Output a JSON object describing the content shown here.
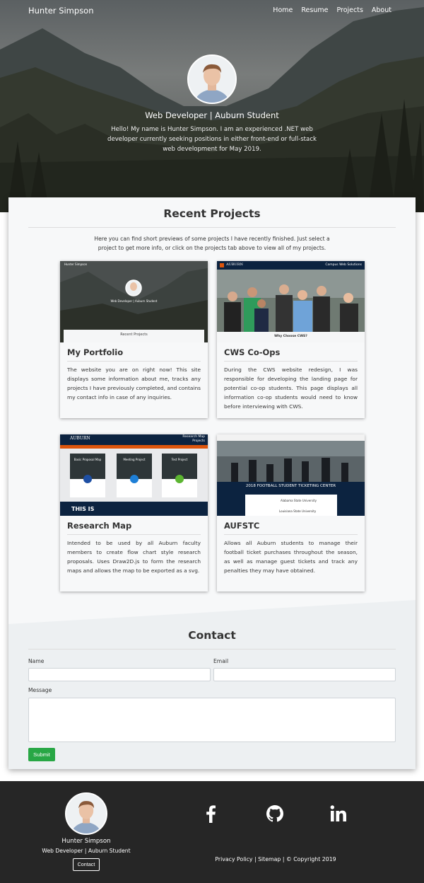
{
  "brand": "Hunter Simpson",
  "nav": [
    "Home",
    "Resume",
    "Projects",
    "About"
  ],
  "hero": {
    "tagline": "Web Developer | Auburn Student",
    "intro": "Hello! My name is Hunter Simpson. I am an experienced .NET web developer currently seeking positions in either front-end or full-stack web development for May 2019."
  },
  "projects": {
    "title": "Recent Projects",
    "intro": "Here you can find short previews of some projects I have recently finished. Just select a project to get more info, or click on the projects tab above to view all of my projects.",
    "items": [
      {
        "title": "My Portfolio",
        "description": "The website you are on right now! This site displays some information about me, tracks any projects I have previously completed, and contains my contact info in case of any inquiries.",
        "thumb": {
          "nav": "Hunter Simpson",
          "tagline": "Web Developer | Auburn Student",
          "button": "Recent Projects"
        }
      },
      {
        "title": "CWS Co-Ops",
        "description": "During the CWS website redesign, I was responsible for developing the landing page for potential co-op students. This page displays all information co-op students would need to know before interviewing with CWS.",
        "thumb": {
          "brand": "AUBURN",
          "right": "Campus Web Solutions",
          "caption": "Why Choose CWS?"
        }
      },
      {
        "title": "Research Map",
        "description": "Intended to be used by all Auburn faculty members to create flow chart style research proposals. Uses Draw2D.js to form the research maps and allows the map to be exported as a svg.",
        "thumb": {
          "brand": "AUBURN",
          "right": "Research Map",
          "right2": "Projects",
          "tiles": [
            "Basic Proposal Map",
            "Meeting Project",
            "Test Project"
          ],
          "banner": "THIS IS"
        }
      },
      {
        "title": "AUFSTC",
        "description": "Allows all Auburn students to manage their football ticket purchases throughout the season, as well as manage guest tickets and track any penalties they may have obtained.",
        "thumb": {
          "banner": "2018 FOOTBALL STUDENT TICKETING CENTER",
          "row1": "Alabama State University",
          "row2": "Louisiana State University"
        }
      }
    ]
  },
  "contact": {
    "title": "Contact",
    "name_label": "Name",
    "email_label": "Email",
    "message_label": "Message",
    "submit": "Submit"
  },
  "footer": {
    "name": "Hunter Simpson",
    "tagline": "Web Developer | Auburn Student",
    "contact_button": "Contact",
    "social": [
      "facebook-icon",
      "github-icon",
      "linkedin-icon"
    ],
    "copyright": "Privacy Policy | Sitemap | © Copyright 2019"
  },
  "colors": {
    "submit": "#28a745",
    "footer_bg": "#262626",
    "auburn_navy": "#0c2340",
    "auburn_orange": "#dd550c"
  }
}
